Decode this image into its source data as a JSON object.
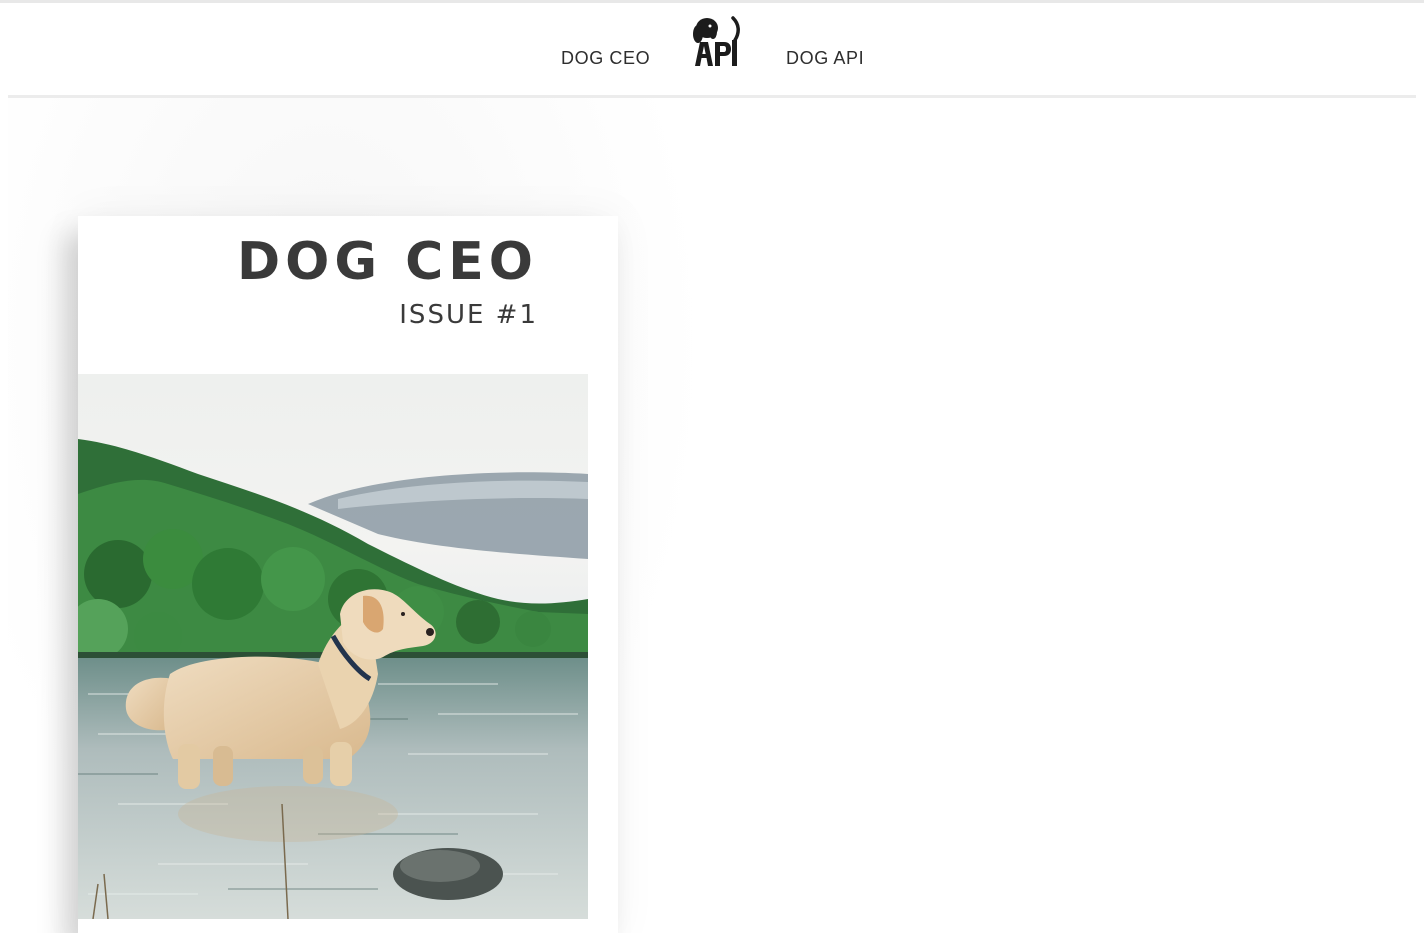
{
  "nav": {
    "left_link": "DOG CEO",
    "right_link": "DOG API",
    "logo_icon": "dog-api-logo-icon",
    "logo_text": "API"
  },
  "cover": {
    "title": "DOG CEO",
    "issue": "ISSUE #1",
    "image_subject": "golden retriever standing in a lake"
  },
  "colors": {
    "text": "#2e2e2e",
    "divider": "#ececec",
    "background": "#ffffff"
  }
}
